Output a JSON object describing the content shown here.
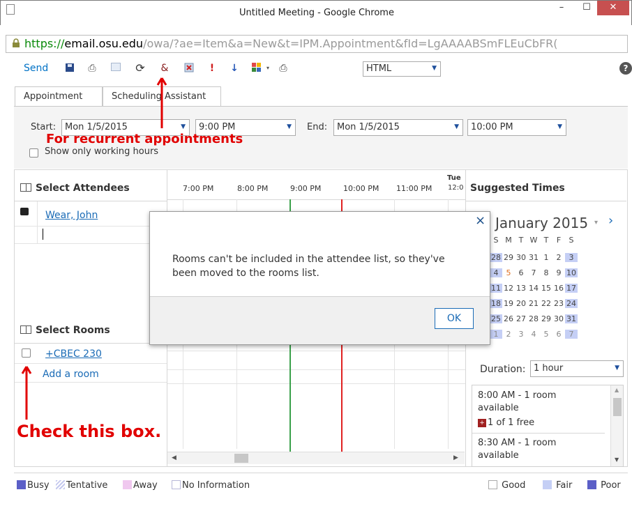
{
  "window": {
    "title": "Untitled Meeting - Google Chrome",
    "minimize": "–",
    "maximize": "☐",
    "close": "✕",
    "url_scheme": "https://",
    "url_host": "email.osu.edu",
    "url_path": "/owa/?ae=Item&a=New&t=IPM.Appointment&fId=LgAAAABSmFLEuCbFR("
  },
  "toolbar": {
    "send": "Send",
    "format": "HTML",
    "help": "?"
  },
  "tabs": [
    "Appointment",
    "Scheduling Assistant"
  ],
  "form": {
    "start_label": "Start:",
    "start_date": "Mon 1/5/2015",
    "start_time": "9:00 PM",
    "end_label": "End:",
    "end_date": "Mon 1/5/2015",
    "end_time": "10:00 PM",
    "working_hours": "Show only working hours"
  },
  "annotations": {
    "recurrent": "For recurrent appointments",
    "checkbox": "Check this box."
  },
  "attendees": {
    "header": "Select Attendees",
    "name": "Wear, John"
  },
  "rooms": {
    "header": "Select Rooms",
    "room": "+CBEC 230",
    "add": "Add a room"
  },
  "timeline": {
    "hours": [
      "7:00 PM",
      "8:00 PM",
      "9:00 PM",
      "10:00 PM",
      "11:00 PM"
    ],
    "next_day": "Tue",
    "next_hour": "12:0"
  },
  "suggested": {
    "header": "Suggested Times",
    "month": "January 2015",
    "weekdays": [
      "S",
      "M",
      "T",
      "W",
      "T",
      "F",
      "S"
    ],
    "weeks": [
      [
        "28",
        "29",
        "30",
        "31",
        "1",
        "2",
        "3"
      ],
      [
        "4",
        "5",
        "6",
        "7",
        "8",
        "9",
        "10"
      ],
      [
        "11",
        "12",
        "13",
        "14",
        "15",
        "16",
        "17"
      ],
      [
        "18",
        "19",
        "20",
        "21",
        "22",
        "23",
        "24"
      ],
      [
        "25",
        "26",
        "27",
        "28",
        "29",
        "30",
        "31"
      ],
      [
        "1",
        "2",
        "3",
        "4",
        "5",
        "6",
        "7"
      ]
    ],
    "duration_label": "Duration:",
    "duration": "1 hour",
    "slot1_line1": "8:00 AM - 1 room",
    "slot1_line2": "available",
    "slot1_free": "1 of 1 free",
    "slot2_line1": "8:30 AM - 1 room",
    "slot2_line2": "available"
  },
  "dialog": {
    "message_line1": "Rooms can't be included in the attendee list, so they've",
    "message_line2": "been moved to the rooms list.",
    "ok": "OK",
    "close": "×"
  },
  "legend": {
    "busy": "Busy",
    "tentative": "Tentative",
    "away": "Away",
    "no_info": "No Information",
    "good": "Good",
    "fair": "Fair",
    "poor": "Poor"
  },
  "colors": {
    "busy": "#5b5fc7",
    "fair": "#c5cff5",
    "annotation": "#e10000",
    "link": "#1a6bb6"
  }
}
